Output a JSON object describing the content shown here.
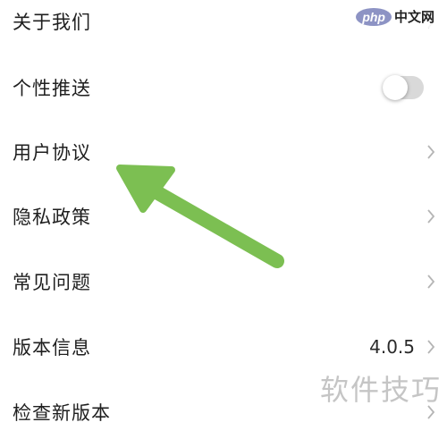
{
  "settings": {
    "items": [
      {
        "label": "关于我们",
        "type": "chevron"
      },
      {
        "label": "个性推送",
        "type": "toggle",
        "enabled": false
      },
      {
        "label": "用户协议",
        "type": "chevron"
      },
      {
        "label": "隐私政策",
        "type": "chevron"
      },
      {
        "label": "常见问题",
        "type": "chevron"
      },
      {
        "label": "版本信息",
        "type": "chevron",
        "value": "4.0.5"
      },
      {
        "label": "检查新版本",
        "type": "chevron"
      }
    ]
  },
  "watermarks": {
    "top_badge": "php",
    "top_text": "中文网",
    "bottom_text": "软件技巧"
  },
  "colors": {
    "arrow": "#7cbf52",
    "toggle_off": "#d9d9d9",
    "chevron": "#b5b5b5"
  }
}
